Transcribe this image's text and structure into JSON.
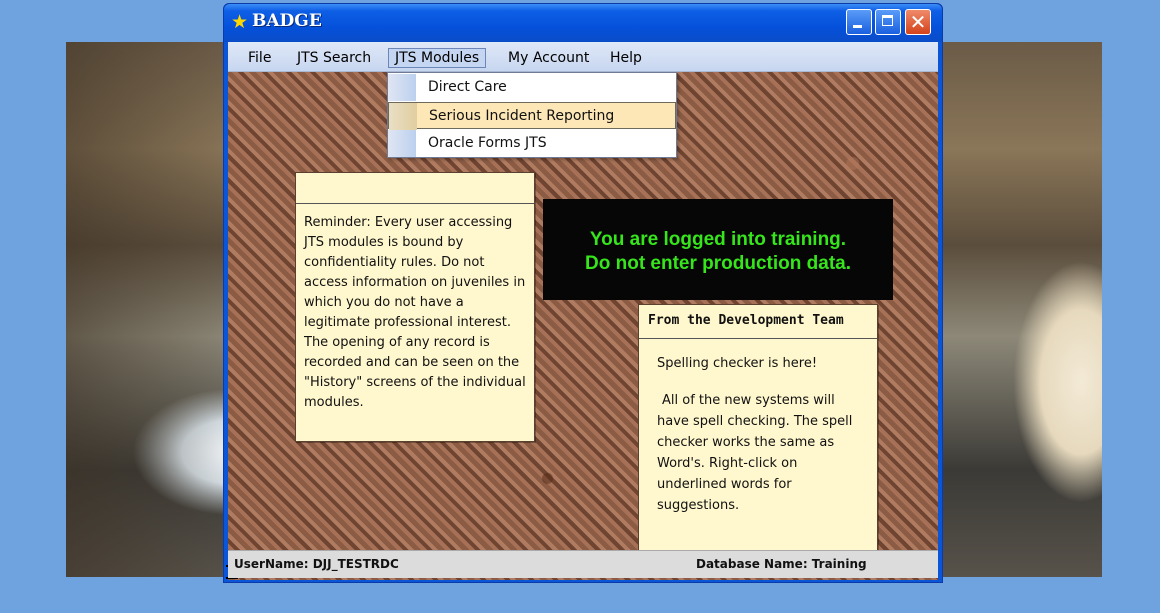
{
  "window": {
    "title": "BADGE",
    "controls": [
      "minimize",
      "maximize",
      "close"
    ]
  },
  "menu": {
    "items": [
      "File",
      "JTS Search",
      "JTS Modules",
      "My Account",
      "Help"
    ],
    "active": "JTS Modules"
  },
  "dropdown": {
    "items": [
      "Direct Care",
      "Serious Incident Reporting",
      "Oracle Forms JTS"
    ],
    "selected": "Serious Incident Reporting"
  },
  "notes": {
    "reminder": {
      "text": "Reminder:  Every user accessing JTS modules is bound by confidentiality rules.  Do not access information on juveniles in which you do not have a legitimate professional interest.  The opening of any record is recorded and can be seen on the \"History\" screens of the individual modules."
    },
    "dev_team": {
      "title": "From the Development Team",
      "para1": "Spelling checker is here!",
      "para2": "All of the new systems will have spell checking.  The spell checker works the same as Word's.  Right-click on underlined words for suggestions."
    }
  },
  "training_banner": {
    "line1": "You are logged into training.",
    "line2": "Do not enter production data."
  },
  "status": {
    "user": "UserName: DJJ_TESTRDC",
    "database": "Database Name: Training"
  },
  "colors": {
    "banner_text": "#36e51b",
    "note_bg": "#fff7cd",
    "titlebar": "#0551db"
  }
}
